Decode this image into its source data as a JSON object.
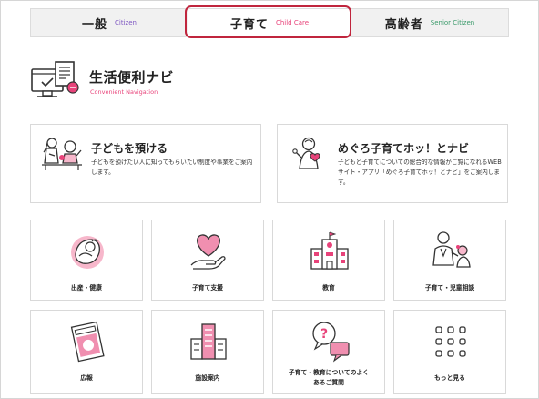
{
  "tabs": [
    {
      "label": "一般",
      "sublabel": "Citizen"
    },
    {
      "label": "子育て",
      "sublabel": "Child Care"
    },
    {
      "label": "高齢者",
      "sublabel": "Senior Citizen"
    }
  ],
  "section": {
    "title": "生活便利ナビ",
    "subtitle": "Convenient Navigation",
    "icon": "computer-document-icon"
  },
  "feature_cards": [
    {
      "title": "子どもを預ける",
      "description": "子どもを預けたい人に知ってもらいたい制度や事業をご案内します。",
      "icon": "childcare-people-icon"
    },
    {
      "title": "めぐろ子育てホッ！とナビ",
      "description": "子どもと子育てについての総合的な情報がご覧になれるWEBサイト・アプリ「めぐろ子育てホッ！とナビ」をご案内します。",
      "icon": "parent-heart-icon"
    }
  ],
  "grid": [
    {
      "label": "出産・健康",
      "icon": "baby-icon"
    },
    {
      "label": "子育て支援",
      "icon": "heart-hand-icon"
    },
    {
      "label": "教育",
      "icon": "school-building-icon"
    },
    {
      "label": "子育て・児童相談",
      "icon": "consultation-icon"
    },
    {
      "label": "広報",
      "icon": "newsletter-icon"
    },
    {
      "label": "施設案内",
      "icon": "facility-building-icon"
    },
    {
      "label": "子育て・教育についてのよくあるご質問",
      "icon": "question-bubble-icon"
    },
    {
      "label": "もっと見る",
      "icon": "grid-dots-icon"
    }
  ],
  "colors": {
    "accent": "#e8437a",
    "highlight_border": "#c0253d",
    "citizen": "#7e57c2",
    "senior": "#3a9a6a"
  }
}
